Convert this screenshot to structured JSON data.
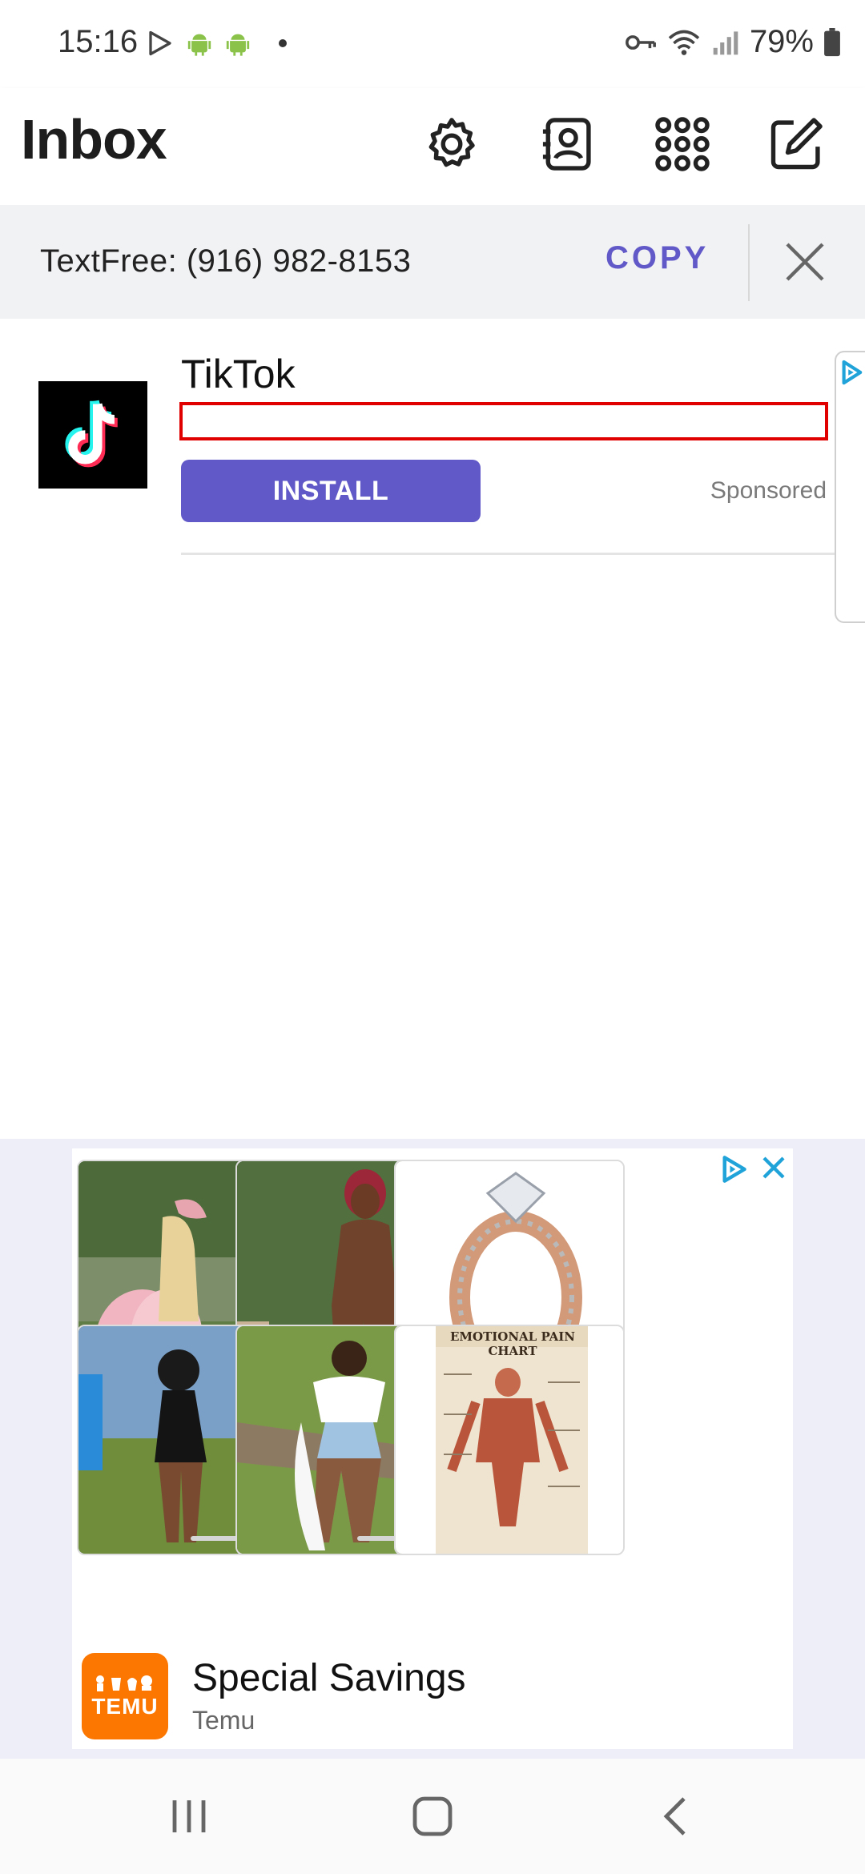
{
  "status_bar": {
    "time": "15:16",
    "battery_percent": "79%",
    "icons": [
      "play-store-icon",
      "android-icon",
      "android-icon",
      "dot-icon",
      "vpn-key-icon",
      "wifi-icon",
      "signal-icon",
      "battery-icon"
    ]
  },
  "header": {
    "title": "Inbox",
    "actions": [
      "settings-icon",
      "contacts-icon",
      "apps-grid-icon",
      "compose-icon"
    ]
  },
  "number_banner": {
    "text": "TextFree: (916) 982-8153",
    "copy_label": "COPY"
  },
  "native_ad": {
    "app_name": "TikTok",
    "install_label": "INSTALL",
    "sponsored_label": "Sponsored"
  },
  "banner_ad": {
    "title": "Special Savings",
    "advertiser": "Temu",
    "logo_text": "TEMU",
    "ring_tile_text": "",
    "chart_tile_title": "EMOTIONAL PAIN CHART"
  },
  "colors": {
    "accent": "#6259c8",
    "temu_orange": "#fb7701",
    "banner_bg": "#f1f2f4",
    "red_outline": "#e00000"
  }
}
